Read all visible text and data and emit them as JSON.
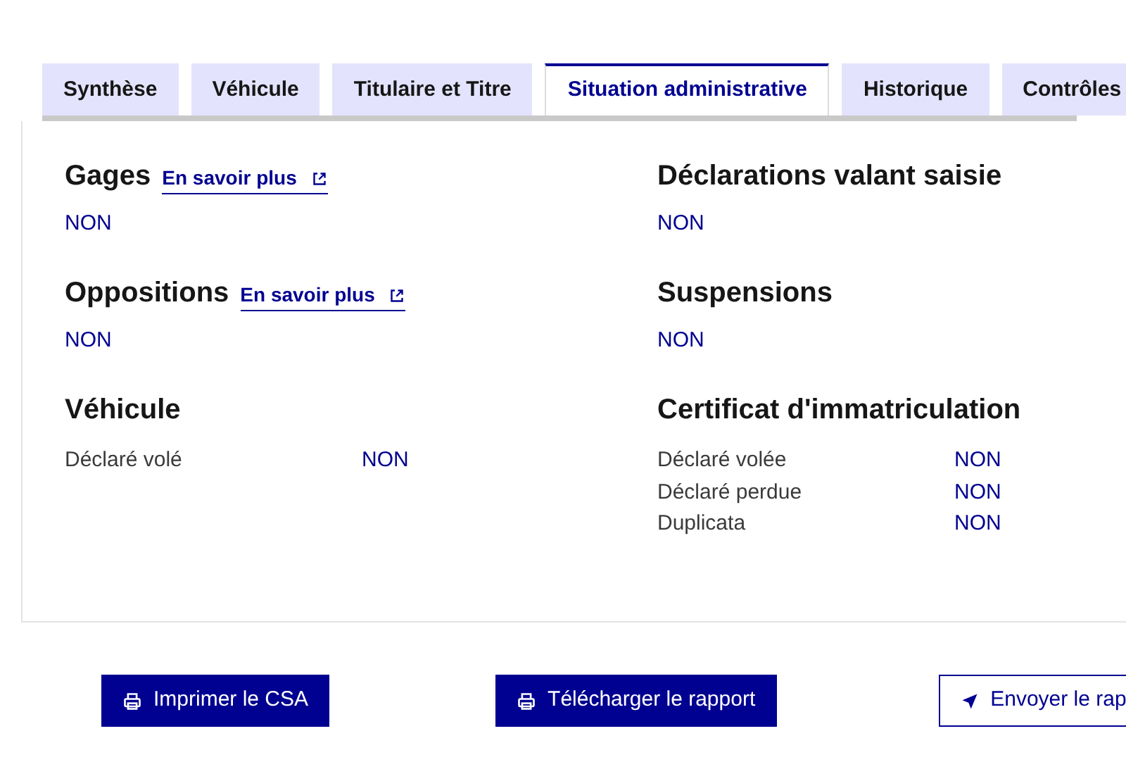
{
  "tabs": [
    {
      "label": "Synthèse",
      "selected": false
    },
    {
      "label": "Véhicule",
      "selected": false
    },
    {
      "label": "Titulaire et Titre",
      "selected": false
    },
    {
      "label": "Situation administrative",
      "selected": true
    },
    {
      "label": "Historique",
      "selected": false
    },
    {
      "label": "Contrôles",
      "selected": false
    }
  ],
  "sections": [
    {
      "kind": "value",
      "title": "Gages",
      "link": "En savoir plus",
      "value": "NON"
    },
    {
      "kind": "value",
      "title": "Déclarations valant saisie",
      "value": "NON"
    },
    {
      "kind": "value",
      "title": "Oppositions",
      "link": "En savoir plus",
      "value": "NON"
    },
    {
      "kind": "value",
      "title": "Suspensions",
      "value": "NON"
    },
    {
      "kind": "rows",
      "title": "Véhicule",
      "rows": [
        {
          "label": "Déclaré volé",
          "value": "NON"
        }
      ]
    },
    {
      "kind": "rows",
      "title": "Certificat d'immatriculation",
      "rows": [
        {
          "label": "Déclaré volée",
          "value": "NON"
        },
        {
          "label": "Déclaré perdue",
          "value": "NON"
        },
        {
          "label": "Duplicata",
          "value": "NON"
        }
      ]
    }
  ],
  "buttons": [
    {
      "label": "Imprimer le CSA",
      "kind": "primary"
    },
    {
      "label": "Télécharger le rapport",
      "kind": "primary"
    },
    {
      "label": "Envoyer le rap",
      "kind": "secondary"
    }
  ]
}
